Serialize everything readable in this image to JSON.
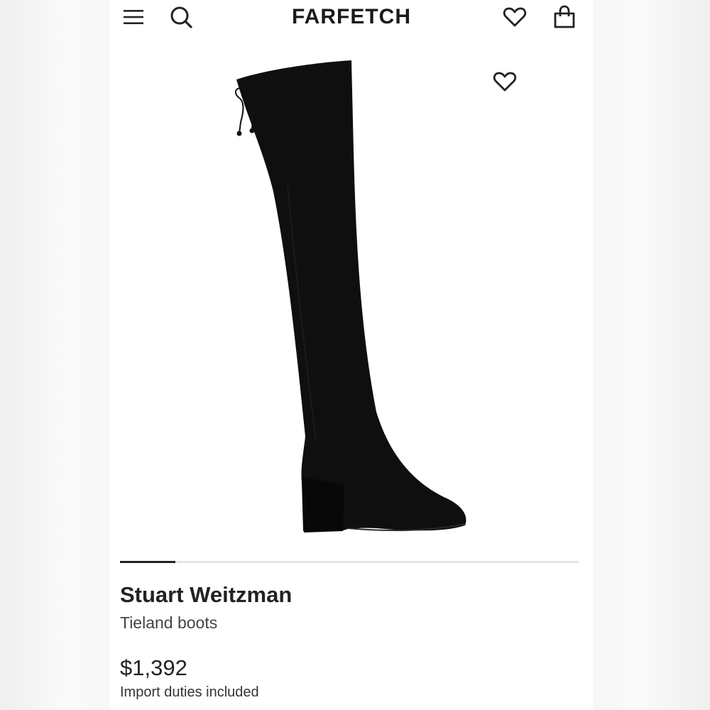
{
  "header": {
    "logo": "FARFETCH",
    "icons": [
      "menu-icon",
      "search-icon",
      "heart-icon",
      "shopping-bag-icon"
    ]
  },
  "product": {
    "brand": "Stuart Weitzman",
    "name": "Tieland boots",
    "price": "$1,392",
    "duties_note": "Import duties included",
    "image_icon": "boot-image",
    "wishlist_icon": "heart-icon"
  },
  "gallery": {
    "progress": 0.12
  },
  "colors": {
    "text": "#222222",
    "background": "#ffffff",
    "boot": "#111111"
  }
}
